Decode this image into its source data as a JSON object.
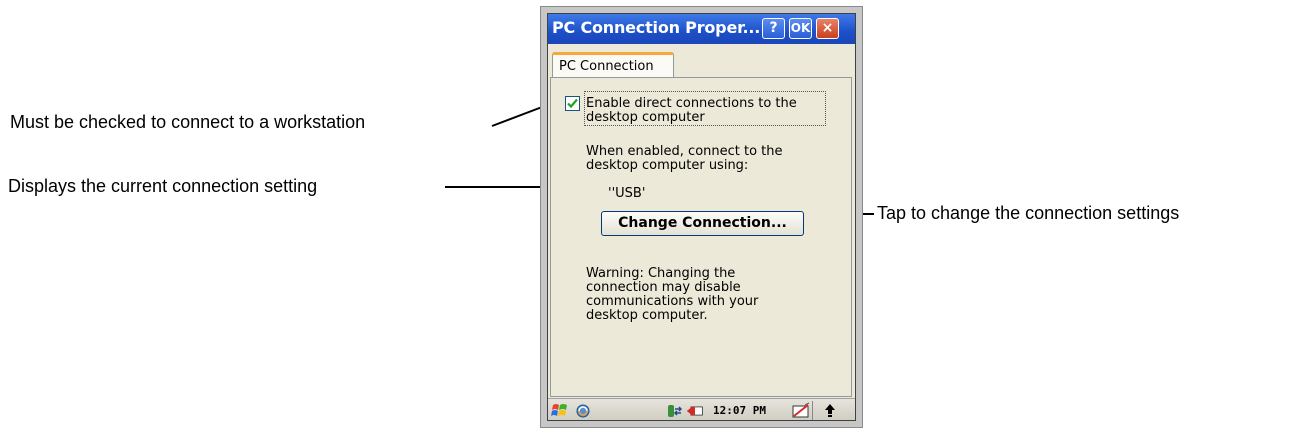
{
  "callouts": {
    "checked": "Must be checked to connect to a workstation",
    "current": "Displays the current connection setting",
    "change": "Tap to change the connection settings"
  },
  "window": {
    "title": "PC Connection Proper...",
    "help_label": "?",
    "ok_label": "OK",
    "close_label": "×"
  },
  "tab": {
    "label": "PC Connection"
  },
  "content": {
    "checkbox_checked": true,
    "checkbox_label_line1": "Enable direct connections to the",
    "checkbox_label_line2": "desktop computer",
    "info_line1": "When enabled, connect to the",
    "info_line2": "desktop computer using:",
    "connection_value": "''USB'",
    "change_button": "Change Connection...",
    "warning_line1": "Warning: Changing the",
    "warning_line2": "connection may disable",
    "warning_line3": "communications with your",
    "warning_line4": "desktop computer."
  },
  "taskbar": {
    "time": "12:07 PM",
    "icons": [
      "start-icon",
      "sync-icon",
      "connection-icon",
      "battery-icon",
      "input-panel-icon",
      "up-arrow-icon"
    ]
  },
  "colors": {
    "titlebar": "#1d4fc9",
    "close_button": "#c8401e",
    "check_mark": "#21a121",
    "window_bg": "#ece9d8"
  }
}
